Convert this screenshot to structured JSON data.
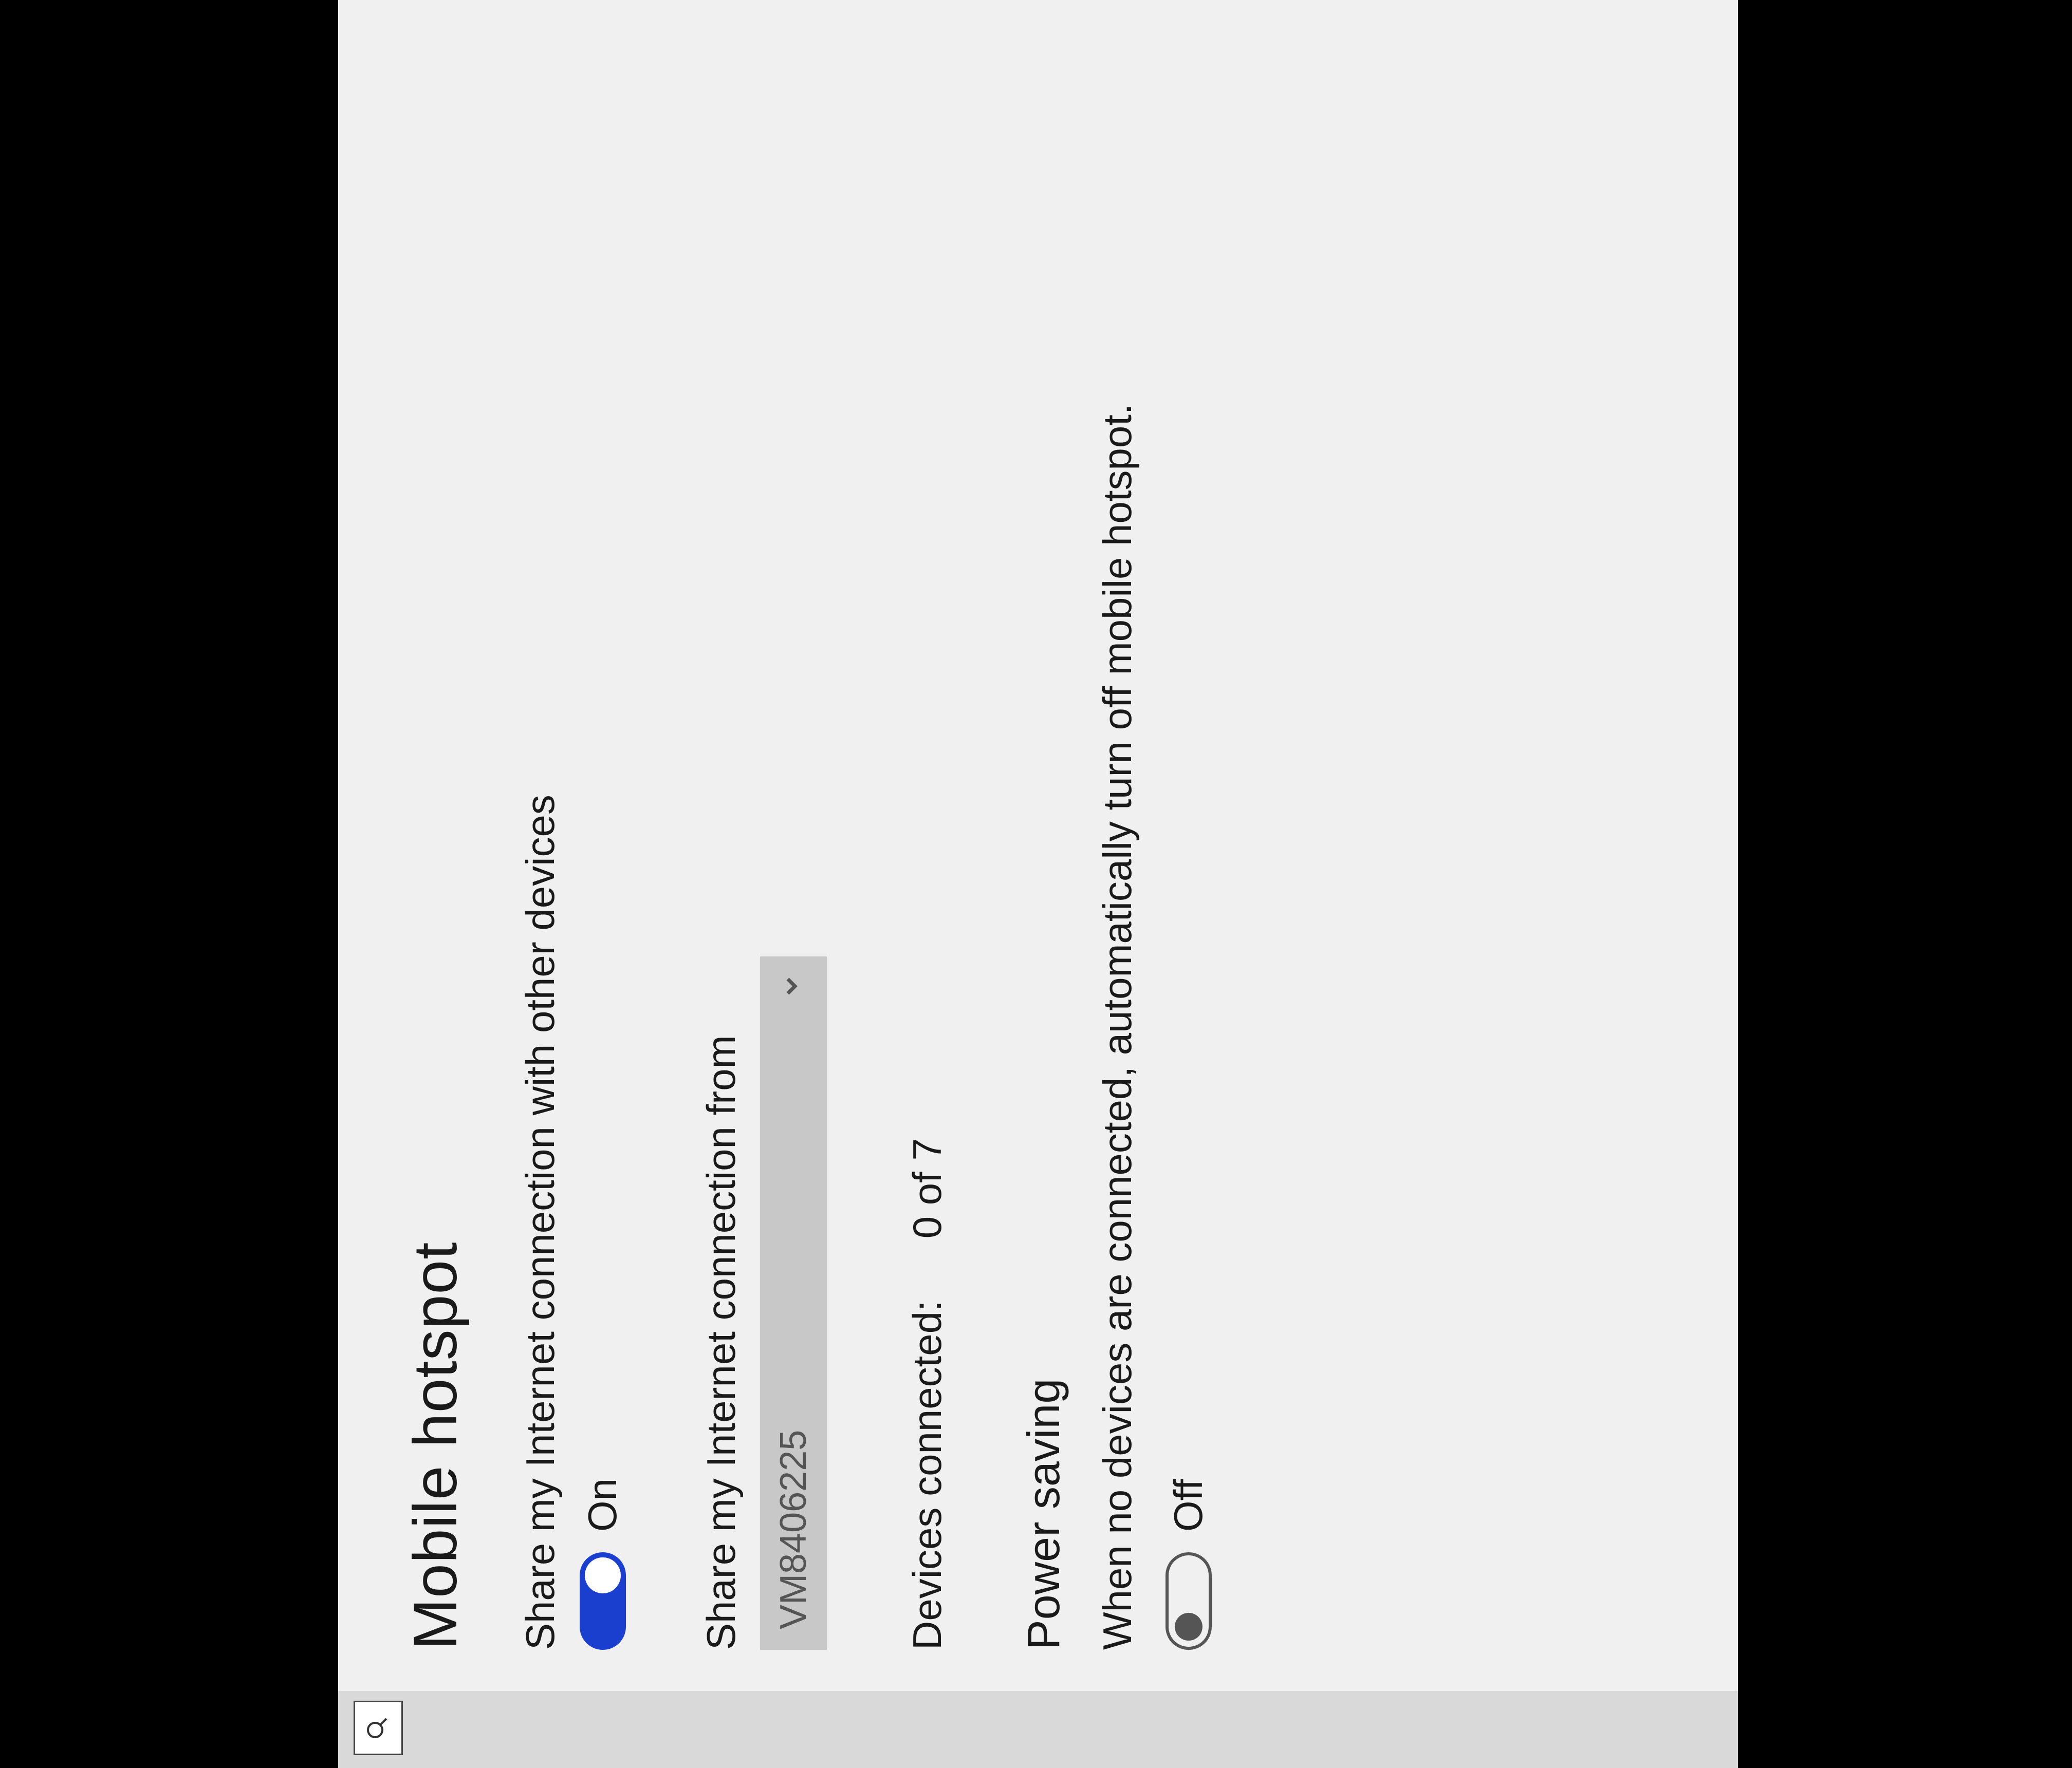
{
  "page": {
    "title": "Mobile hotspot"
  },
  "share_connection": {
    "label": "Share my Internet connection with other devices",
    "toggle_state": "On"
  },
  "share_from": {
    "label": "Share my Internet connection from",
    "selected": "VM8406225"
  },
  "devices": {
    "label": "Devices connected:",
    "value": "0 of 7"
  },
  "power_saving": {
    "title": "Power saving",
    "description": "When no devices are connected, automatically turn off mobile hotspot.",
    "toggle_state": "Off"
  }
}
